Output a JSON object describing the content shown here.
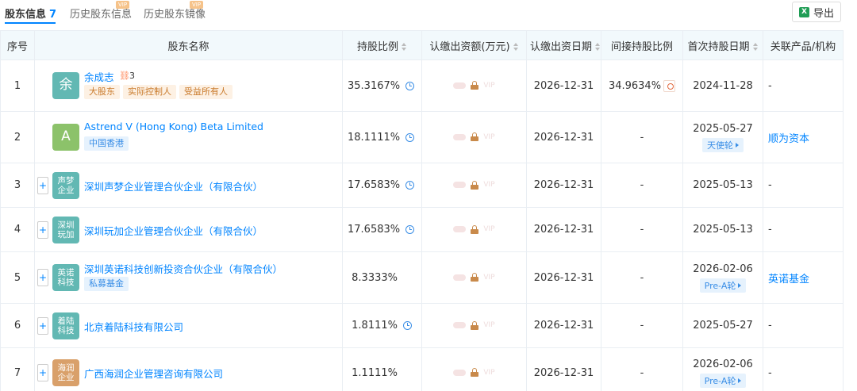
{
  "tabs": [
    {
      "label": "股东信息",
      "count": "7"
    },
    {
      "label": "历史股东信息",
      "badge": "VIP"
    },
    {
      "label": "历史股东镜像",
      "badge": "VIP"
    }
  ],
  "export": {
    "label": "导出",
    "icon": "excel-icon"
  },
  "columns": {
    "seq": "序号",
    "name": "股东名称",
    "ratio": "持股比例",
    "amount": "认缴出资额(万元)",
    "date": "认缴出资日期",
    "indirect": "间接持股比例",
    "first_date": "首次持股日期",
    "related": "关联产品/机构"
  },
  "vip_placeholder": "VIP",
  "rows": [
    {
      "seq": "1",
      "logo_text": "余",
      "logo_color": "#62b8b3",
      "name": "余成志",
      "relation_count": "3",
      "tags": [
        {
          "text": "大股东",
          "style": "orange"
        },
        {
          "text": "实际控制人",
          "style": "orange"
        },
        {
          "text": "受益所有人",
          "style": "orange"
        }
      ],
      "ratio": "35.3167%",
      "date": "2026-12-31",
      "indirect": "34.9634%",
      "first_date": "2024-11-28",
      "round": "",
      "related": "-"
    },
    {
      "seq": "2",
      "logo_text": "A",
      "logo_color": "#8cc26a",
      "name": "Astrend V (Hong Kong) Beta Limited",
      "tags": [
        {
          "text": "中国香港",
          "style": "blue"
        }
      ],
      "ratio": "18.1111%",
      "date": "2026-12-31",
      "indirect": "-",
      "first_date": "2025-05-27",
      "round": "天使轮",
      "related": "顺为资本"
    },
    {
      "seq": "3",
      "logo_text": "声梦企业",
      "logo_color": "#62b8b3",
      "name": "深圳声梦企业管理合伙企业（有限合伙）",
      "tags": [],
      "ratio": "17.6583%",
      "date": "2026-12-31",
      "indirect": "-",
      "first_date": "2025-05-13",
      "round": "",
      "related": "-"
    },
    {
      "seq": "4",
      "logo_text": "深圳玩加",
      "logo_color": "#62b8b3",
      "name": "深圳玩加企业管理合伙企业（有限合伙）",
      "tags": [],
      "ratio": "17.6583%",
      "date": "2026-12-31",
      "indirect": "-",
      "first_date": "2025-05-13",
      "round": "",
      "related": "-"
    },
    {
      "seq": "5",
      "logo_text": "英诺科技",
      "logo_color": "#62b8b3",
      "name": "深圳英诺科技创新投资合伙企业（有限合伙）",
      "tags": [
        {
          "text": "私募基金",
          "style": "blue"
        }
      ],
      "ratio": "8.3333%",
      "date": "2026-12-31",
      "indirect": "-",
      "first_date": "2026-02-06",
      "round": "Pre-A轮",
      "related": "英诺基金"
    },
    {
      "seq": "6",
      "logo_text": "着陆科技",
      "logo_color": "#62b8b3",
      "name": "北京着陆科技有限公司",
      "tags": [],
      "ratio": "1.8111%",
      "date": "2026-12-31",
      "indirect": "-",
      "first_date": "2025-05-27",
      "round": "",
      "related": "-"
    },
    {
      "seq": "7",
      "logo_text": "海润企业",
      "logo_color": "#d9a06a",
      "name": "广西海润企业管理咨询有限公司",
      "tags": [],
      "ratio": "1.1111%",
      "date": "2026-12-31",
      "indirect": "-",
      "first_date": "2026-02-06",
      "round": "Pre-A轮",
      "related": "-"
    }
  ]
}
